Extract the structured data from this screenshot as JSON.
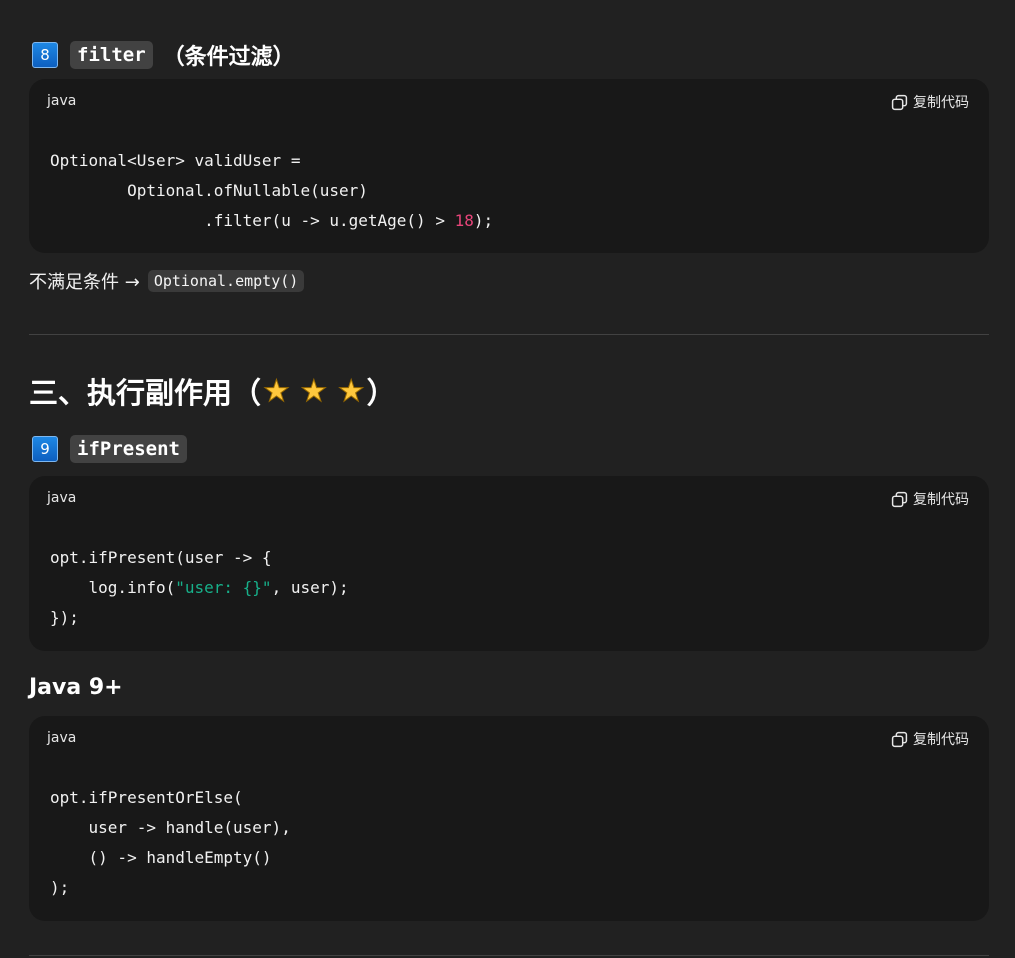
{
  "section_filter": {
    "badge": "8",
    "code_label": "filter",
    "suffix": "（条件过滤）"
  },
  "code_blocks": [
    {
      "lang": "java",
      "copy_label": "复制代码",
      "lines": [
        "Optional<User> validUser =",
        "        Optional.ofNullable(user)",
        "                .filter(u -> u.getAge() > ",
        "18",
        ");"
      ]
    },
    {
      "lang": "java",
      "copy_label": "复制代码",
      "lines": [
        "opt.ifPresent(user -> {",
        "    log.info(",
        "\"user: {}\"",
        ", user);",
        "});"
      ]
    },
    {
      "lang": "java",
      "copy_label": "复制代码",
      "lines": [
        "opt.ifPresentOrElse(",
        "    user -> handle(user),",
        "    () -> handleEmpty()",
        ");"
      ]
    }
  ],
  "para_filter": {
    "text": "不满足条件 →",
    "code": "Optional.empty()"
  },
  "section3": {
    "title": "三、执行副作用（",
    "stars": "★ ★ ★",
    "close": "）"
  },
  "section_ifpresent": {
    "badge": "9",
    "code_label": "ifPresent"
  },
  "java9_heading": "Java 9+",
  "colors": {
    "background": "#212121",
    "code_background": "#181818",
    "number": "#e8457a",
    "string": "#17b08a",
    "badge_blue": "#1e88e5",
    "star": "#ffc83d"
  },
  "icons": {
    "copy": "copy-icon",
    "keycap": "keycap-digit-icon",
    "star": "star-icon"
  }
}
